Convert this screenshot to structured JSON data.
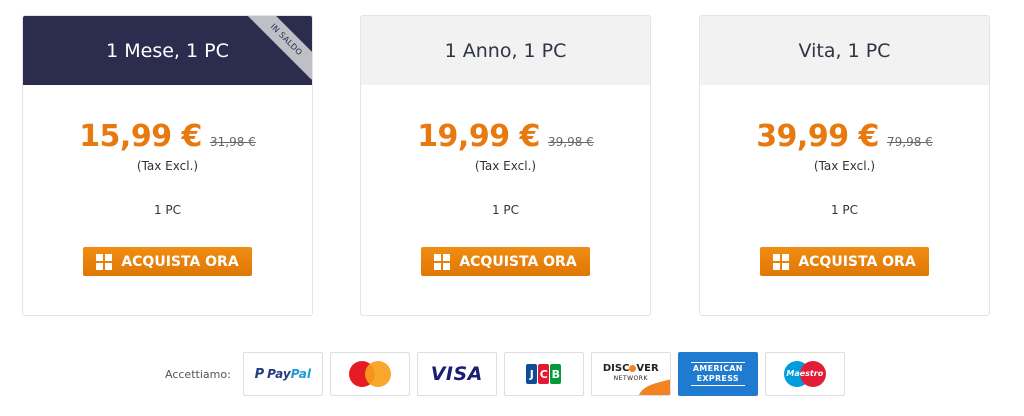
{
  "plans": [
    {
      "title": "1 Mese, 1 PC",
      "ribbon": "IN SALDO",
      "price": "15,99 €",
      "old_price": "31,98 €",
      "tax": "(Tax Excl.)",
      "pcs": "1 PC",
      "button": "ACQUISTA ORA"
    },
    {
      "title": "1 Anno, 1 PC",
      "price": "19,99 €",
      "old_price": "39,98 €",
      "tax": "(Tax Excl.)",
      "pcs": "1 PC",
      "button": "ACQUISTA ORA"
    },
    {
      "title": "Vita, 1 PC",
      "price": "39,99 €",
      "old_price": "79,98 €",
      "tax": "(Tax Excl.)",
      "pcs": "1 PC",
      "button": "ACQUISTA ORA"
    }
  ],
  "payments": {
    "label": "Accettiamo:",
    "methods": {
      "paypal": {
        "mark": "P",
        "name1": "Pay",
        "name2": "Pal"
      },
      "mastercard": {
        "icon": "mastercard-icon"
      },
      "visa": {
        "name": "VISA"
      },
      "jcb": {
        "j": "J",
        "c": "C",
        "b": "B"
      },
      "discover": {
        "name1": "DISC",
        "name2": "VER",
        "sub": "NETWORK"
      },
      "amex": {
        "line1": "AMERICAN",
        "line2": "EXPRESS"
      },
      "maestro": {
        "name": "Maestro"
      }
    }
  },
  "colors": {
    "header_dark": "#2c2c4e",
    "header_light": "#f2f2f3",
    "price_orange": "#e8790f",
    "button_orange": "#f08d12"
  }
}
